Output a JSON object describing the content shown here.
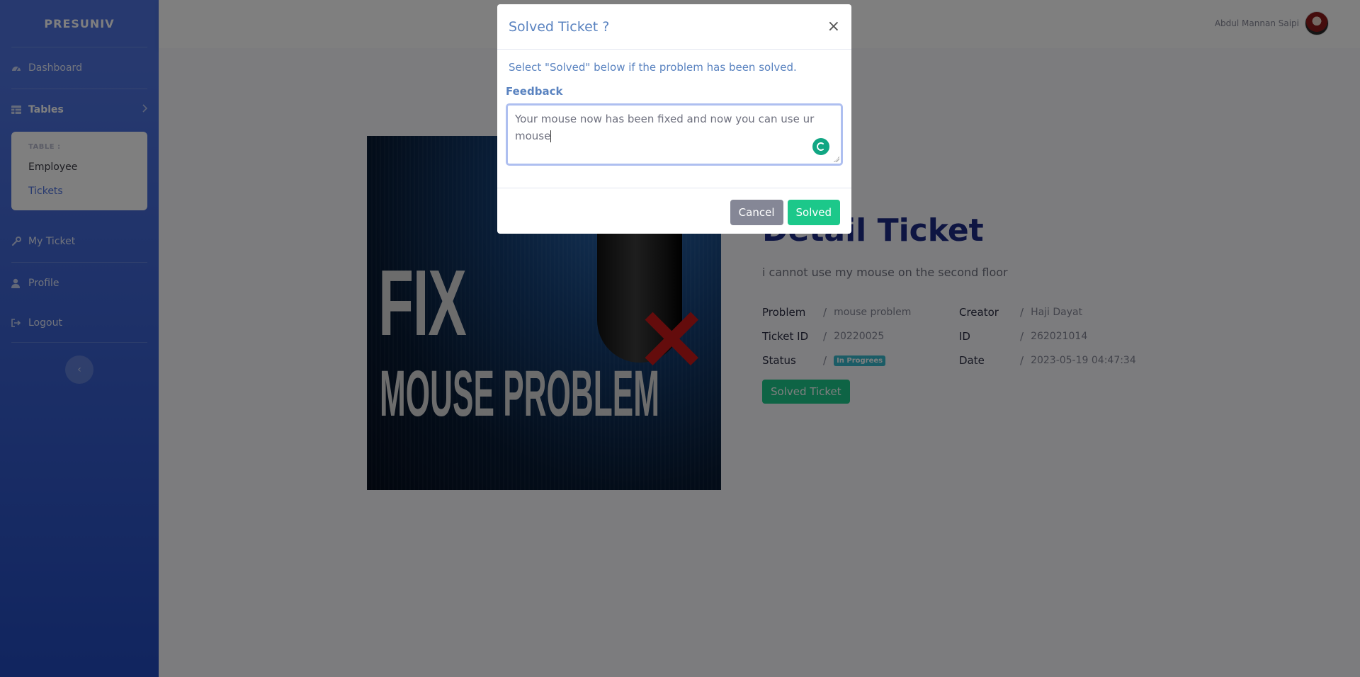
{
  "sidebar": {
    "brand": "PRESUNIV",
    "dashboard": "Dashboard",
    "tables": "Tables",
    "tables_header": "TABLE :",
    "tables_items": [
      "Employee",
      "Tickets"
    ],
    "my_ticket": "My Ticket",
    "profile": "Profile",
    "logout": "Logout"
  },
  "topbar": {
    "user_name": "Abdul Mannan Saipi"
  },
  "ticket": {
    "image_text_top": "FIX",
    "image_text_bottom": "MOUSE PROBLEM",
    "title": "Detail Ticket",
    "description": "i cannot use my mouse on the second floor",
    "fields": {
      "problem": {
        "label": "Problem",
        "value": "mouse problem"
      },
      "ticket_id": {
        "label": "Ticket ID",
        "value": "20220025"
      },
      "status": {
        "label": "Status",
        "value": "In Progrees"
      },
      "creator": {
        "label": "Creator",
        "value": "Haji Dayat"
      },
      "id": {
        "label": "ID",
        "value": "262021014"
      },
      "date": {
        "label": "Date",
        "value": "2023-05-19 04:47:34"
      }
    },
    "separator": "/",
    "solved_button": "Solved Ticket"
  },
  "modal": {
    "title": "Solved Ticket ?",
    "close": "×",
    "message": "Select \"Solved\" below if the problem has been solved.",
    "feedback_label": "Feedback",
    "feedback_value": "Your mouse now has been fixed and now you can use ur mouse",
    "cancel": "Cancel",
    "solved": "Solved"
  },
  "colors": {
    "sidebar": "#4e73df",
    "success": "#1cc88a",
    "info": "#36b9cc",
    "secondary": "#858796"
  }
}
